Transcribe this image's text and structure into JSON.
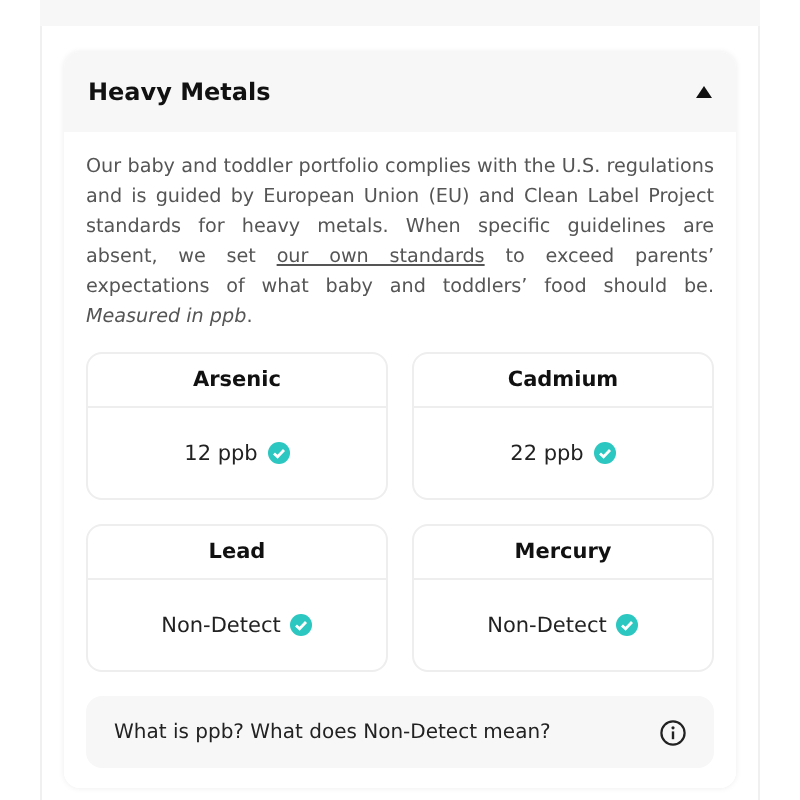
{
  "accordion": {
    "title": "Heavy Metals",
    "expanded": true,
    "description": {
      "before": "Our baby and toddler portfolio complies with the U.S. regulations and is guided by European Union (EU) and Clean Label Project standards for heavy metals. When specific guidelines are absent, we set",
      "link": "our own standards",
      "after": "to exceed parents’ expectations of what baby and toddlers’ food should be. *Measured in ppb*."
    },
    "metals": [
      {
        "name": "Arsenic",
        "value": "12 ppb"
      },
      {
        "name": "Cadmium",
        "value": "22 ppb"
      },
      {
        "name": "Lead",
        "value": "Non-Detect"
      },
      {
        "name": "Mercury",
        "value": "Non-Detect"
      }
    ],
    "faq": "What is ppb? What does Non-Detect mean?"
  }
}
